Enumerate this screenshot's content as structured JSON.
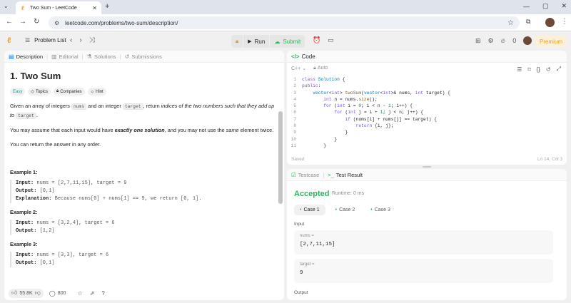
{
  "browser": {
    "tab_title": "Two Sum - LeetCode",
    "url": "leetcode.com/problems/two-sum/description/"
  },
  "header": {
    "problem_list": "Problem List",
    "run": "Run",
    "submit": "Submit",
    "streak": "0",
    "premium": "Premium"
  },
  "left_tabs": [
    "Description",
    "Editorial",
    "Solutions",
    "Submissions"
  ],
  "problem": {
    "title": "1. Two Sum",
    "chips": [
      "Easy",
      "Topics",
      "Companies",
      "Hint"
    ],
    "p1_a": "Given an array of integers ",
    "p1_code1": "nums",
    "p1_b": " and an integer ",
    "p1_code2": "target",
    "p1_c": ", return ",
    "p1_it": "indices of the two numbers such that they add up to",
    "p1_code3": "target",
    "p1_end": ".",
    "p2_a": "You may assume that each input would have ",
    "p2_bold": "exactly one solution",
    "p2_b": ", and you may not use the ",
    "p2_it": "same",
    "p2_c": " element twice.",
    "p3": "You can return the answer in any order.",
    "examples": [
      {
        "heading": "Example 1:",
        "input_label": "Input:",
        "input": " nums = [2,7,11,15], target = 9",
        "output_label": "Output:",
        "output": " [0,1]",
        "explanation_label": "Explanation:",
        "explanation": " Because nums[0] + nums[1] == 9, we return [0, 1]."
      },
      {
        "heading": "Example 2:",
        "input_label": "Input:",
        "input": " nums = [3,2,4], target = 6",
        "output_label": "Output:",
        "output": " [1,2]"
      },
      {
        "heading": "Example 3:",
        "input_label": "Input:",
        "input": " nums = [3,3], target = 6",
        "output_label": "Output:",
        "output": " [0,1]"
      }
    ],
    "likes": "55.8K",
    "comments": "800"
  },
  "code_panel": {
    "tab": "Code",
    "language": "C++",
    "auto": "Auto",
    "saved": "Saved",
    "cursor": "Ln 14, Col 3",
    "line_numbers": [
      "1",
      "2",
      "3",
      "4",
      "5",
      "6",
      "7",
      "8",
      "9",
      "10",
      "11"
    ]
  },
  "result_panel": {
    "tabs": [
      "Testcase",
      "Test Result"
    ],
    "status": "Accepted",
    "runtime": "Runtime: 0 ms",
    "cases": [
      "Case 1",
      "Case 2",
      "Case 3"
    ],
    "input_label": "Input",
    "field1_name": "nums =",
    "field1_value": "[2,7,11,15]",
    "field2_name": "target =",
    "field2_value": "9",
    "output_label": "Output"
  },
  "colors": {
    "accent_green": "#2db55d",
    "leetcode_orange": "#f89f1b",
    "easy": "#00af9b",
    "premium": "#e5a32b"
  }
}
